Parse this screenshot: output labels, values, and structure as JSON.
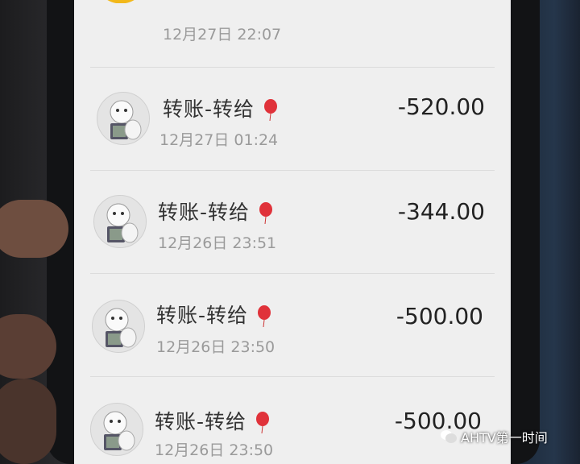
{
  "top_item": {
    "time": "12月27日 22:07",
    "icon": "check-icon",
    "color": "#f2b81a"
  },
  "transactions": [
    {
      "title": "转账-转给",
      "time": "12月27日 01:24",
      "amount": "-520.00"
    },
    {
      "title": "转账-转给",
      "time": "12月26日 23:51",
      "amount": "-344.00"
    },
    {
      "title": "转账-转给",
      "time": "12月26日 23:50",
      "amount": "-500.00"
    },
    {
      "title": "转账-转给",
      "time": "12月26日 23:50",
      "amount": "-500.00"
    }
  ],
  "watermark": {
    "text": "AHTV第一时间",
    "icon": "wechat-icon"
  },
  "colors": {
    "balloon": "#e0323a",
    "screen_bg": "#efefef"
  }
}
